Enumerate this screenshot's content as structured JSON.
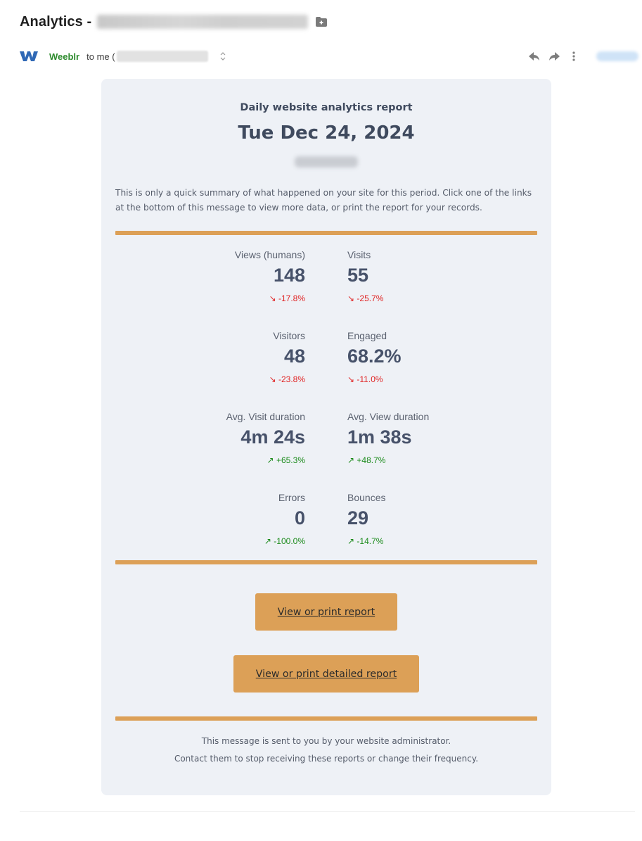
{
  "email": {
    "subject_prefix": "Analytics -",
    "sender": {
      "name": "Weeblr",
      "to_label": "to me ("
    },
    "actions": [
      "reply",
      "forward",
      "more"
    ]
  },
  "report": {
    "heading": "Daily website analytics report",
    "date": "Tue Dec 24, 2024",
    "intro": "This is only a quick summary of what happened on your site for this period. Click one of the links at the bottom of this message to view more data, or print the report for your records.",
    "metrics": [
      {
        "label": "Views (humans)",
        "value": "148",
        "change": "-17.8%",
        "trend": "down",
        "arrow": "↘"
      },
      {
        "label": "Visits",
        "value": "55",
        "change": "-25.7%",
        "trend": "down",
        "arrow": "↘"
      },
      {
        "label": "Visitors",
        "value": "48",
        "change": "-23.8%",
        "trend": "down",
        "arrow": "↘"
      },
      {
        "label": "Engaged",
        "value": "68.2%",
        "change": "-11.0%",
        "trend": "down",
        "arrow": "↘"
      },
      {
        "label": "Avg. Visit duration",
        "value": "4m 24s",
        "change": "+65.3%",
        "trend": "up",
        "arrow": "↗"
      },
      {
        "label": "Avg. View duration",
        "value": "1m 38s",
        "change": "+48.7%",
        "trend": "up",
        "arrow": "↗"
      },
      {
        "label": "Errors",
        "value": "0",
        "change": "-100.0%",
        "trend": "up",
        "arrow": "↗"
      },
      {
        "label": "Bounces",
        "value": "29",
        "change": "-14.7%",
        "trend": "up",
        "arrow": "↗"
      }
    ],
    "buttons": {
      "view_report": "View or print report",
      "view_detailed_report": "View or print detailed report"
    },
    "footer": {
      "line1": "This message is sent to you by your website administrator.",
      "line2": "Contact them to stop receiving these reports or change their frequency."
    }
  },
  "colors": {
    "accent": "#dca057",
    "card_bg": "#eef1f6",
    "negative": "#e02424",
    "positive": "#1a8a1a",
    "sender": "#2e8b2e"
  }
}
